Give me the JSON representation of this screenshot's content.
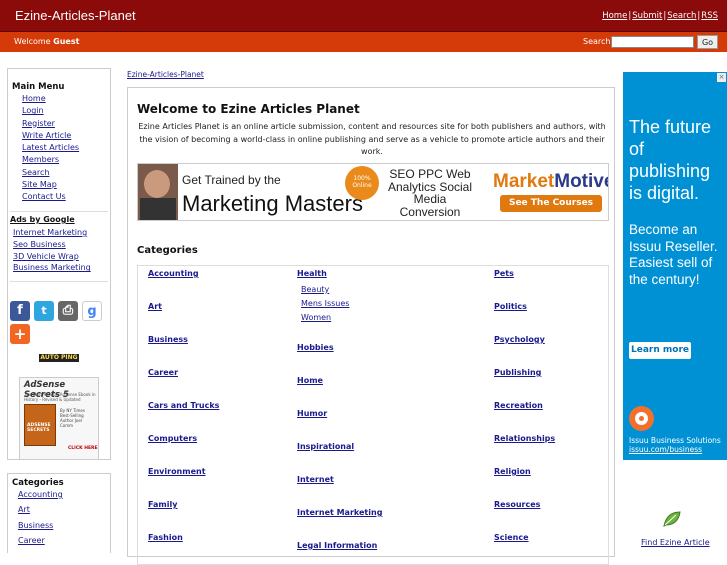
{
  "header": {
    "title": "Ezine-Articles-Planet",
    "links": [
      "Home",
      "Submit",
      "Search",
      "RSS"
    ],
    "separator": "|"
  },
  "subheader": {
    "welcome_prefix": "Welcome",
    "user": "Guest",
    "search_label": "Search:",
    "search_value": "",
    "go_label": "Go"
  },
  "sidebar": {
    "main_menu_title": "Main Menu",
    "main_menu": [
      "Home",
      "Login",
      "Register",
      "Write Article",
      "Latest Articles",
      "Members",
      "Search",
      "Site Map",
      "Contact Us"
    ],
    "ads_title": "Ads by Google",
    "ads": [
      "Internet Marketing",
      "Seo Business",
      "3D Vehicle Wrap",
      "Business Marketing"
    ],
    "social": {
      "facebook": "f",
      "twitter": "t",
      "print": "⎙",
      "google": "g",
      "add": "+"
    },
    "autoping": "AUTO PING",
    "adsense": {
      "title": "AdSense Secrets 5",
      "subtitle": "The Most Popular AdSense Ebook in History - Revised & Updated",
      "book": "ADSENSE SECRETS",
      "byline": "By NY Times Best-Selling Author Joel Comm",
      "click": "CLICK HERE"
    },
    "categories_title": "Categories",
    "categories": [
      "Accounting",
      "Art",
      "Business",
      "Career"
    ]
  },
  "main": {
    "breadcrumb": "Ezine-Articles-Planet",
    "heading": "Welcome to Ezine Articles Planet",
    "intro": "Ezine Articles Planet is an online article submission, content and resources site for both publishers and authors, with the vision of becoming a world-class in online publishing and serve as a vehicle to promote article authors and their work.",
    "banner": {
      "line1": "Get Trained by the",
      "line2": "Marketing Masters",
      "badge": "100% Online",
      "seo": "SEO PPC Web Analytics Social Media Conversion",
      "brand1": "Market",
      "brand2": "Motive",
      "cta": "See The Courses"
    },
    "categories_title": "Categories",
    "col1": [
      "Accounting",
      "Art",
      "Business",
      "Career",
      "Cars and Trucks",
      "Computers",
      "Environment",
      "Family",
      "Fashion"
    ],
    "col2": [
      "Health",
      "Hobbies",
      "Home",
      "Humor",
      "Inspirational",
      "Internet",
      "Internet Marketing",
      "Legal Information"
    ],
    "col2_sub": [
      "Beauty",
      "Mens Issues",
      "Women"
    ],
    "col3": [
      "Pets",
      "Politics",
      "Psychology",
      "Publishing",
      "Recreation",
      "Relationships",
      "Religion",
      "Resources",
      "Science"
    ]
  },
  "right_ad": {
    "big": "The future of publishing is digital.",
    "mid": "Become an Issuu Reseller. Easiest sell of the century!",
    "cta": "Learn more",
    "company": "Issuu Business Solutions",
    "url": "issuu.com/business",
    "close": "×"
  },
  "footer": {
    "find": "Find Ezine Article"
  }
}
